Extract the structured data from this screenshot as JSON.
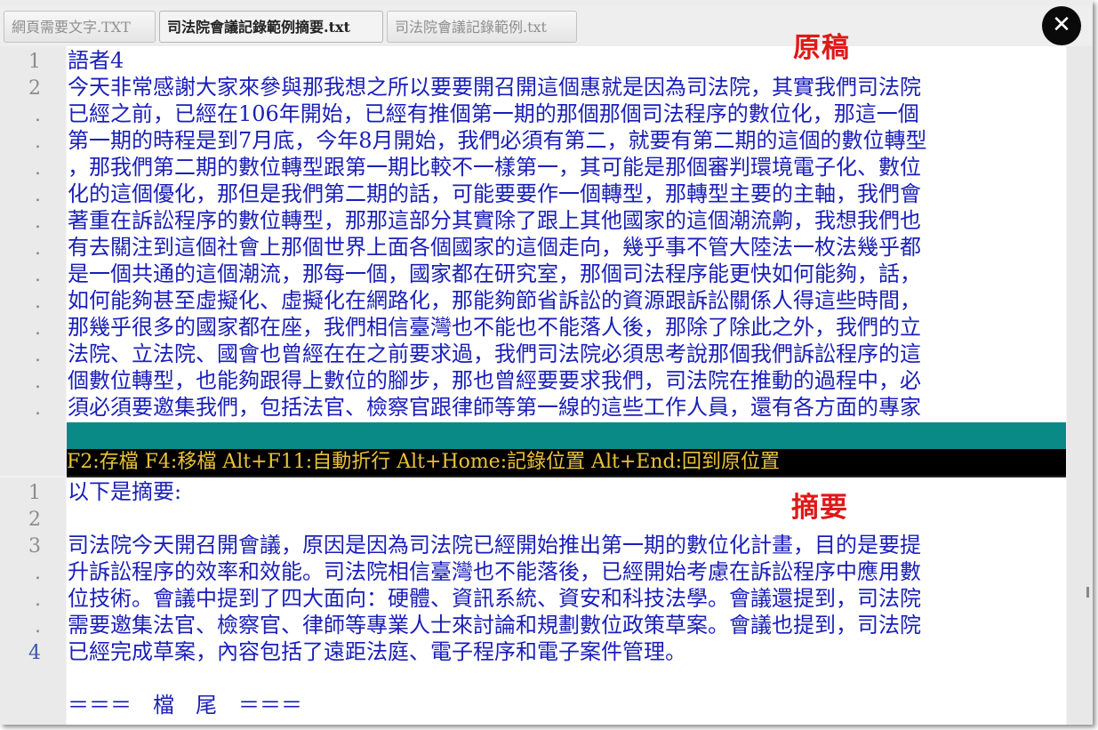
{
  "tabs": [
    {
      "label": "網頁需要文字.TXT",
      "active": false
    },
    {
      "label": "司法院會議記錄範例摘要.txt",
      "active": true
    },
    {
      "label": "司法院會議記錄範例.txt",
      "active": false
    }
  ],
  "close_icon": "close-icon",
  "original": {
    "heading": "原稿",
    "line_numbers": [
      "1",
      "2",
      ".",
      ".",
      ".",
      ".",
      ".",
      ".",
      ".",
      ".",
      ".",
      ".",
      ".",
      ".",
      "."
    ],
    "lines": [
      "語者4",
      "今天非常感謝大家來參與那我想之所以要要開召開這個惠就是因為司法院，其實我們司法院",
      "已經之前，已經在106年開始，已經有推個第一期的那個那個司法程序的數位化，那這一個",
      "第一期的時程是到7月底，今年8月開始，我們必須有第二，就要有第二期的這個的數位轉型",
      "，那我們第二期的數位轉型跟第一期比較不一樣第一，其可能是那個審判環境電子化、數位",
      "化的這個優化，那但是我們第二期的話，可能要要作一個轉型，那轉型主要的主軸，我們會",
      "著重在訴訟程序的數位轉型，那那這部分其實除了跟上其他國家的這個潮流齁，我想我們也",
      "有去關注到這個社會上那個世界上面各個國家的這個走向，幾乎事不管大陸法一枚法幾乎都",
      "是一個共通的這個潮流，那每一個，國家都在研究室，那個司法程序能更快如何能夠，話，",
      "如何能夠甚至虛擬化、虛擬化在網路化，那能夠節省訴訟的資源跟訴訟關係人得這些時間，",
      "那幾乎很多的國家都在座，我們相信臺灣也不能也不能落人後，那除了除此之外，我們的立",
      "法院、立法院、國會也曾經在在之前要求過，我們司法院必須思考說那個我們訴訟程序的這",
      "個數位轉型，也能夠跟得上數位的腳步，那也曾經要要求我們，司法院在推動的過程中，必",
      "須必須要邀集我們，包括法官、檢察官跟律師等第一線的這些工作人員，還有各方面的專家"
    ]
  },
  "status_bar": "F2:存檔 F4:移檔 Alt+F11:自動折行 Alt+Home:記錄位置 Alt+End:回到原位置",
  "summary": {
    "heading": "摘要",
    "line_numbers": [
      "1",
      "2",
      "3",
      ".",
      ".",
      ".",
      "4"
    ],
    "lines": [
      "以下是摘要:",
      "",
      "司法院今天開召開會議，原因是因為司法院已經開始推出第一期的數位化計畫，目的是要提",
      "升訴訟程序的效率和效能。司法院相信臺灣也不能落後，已經開始考慮在訴訟程序中應用數",
      "位技術。會議中提到了四大面向：硬體、資訊系統、資安和科技法學。會議還提到，司法院",
      "需要邀集法官、檢察官、律師等專業人士來討論和規劃數位政策草案。會議也提到，司法院",
      "已經完成草案，內容包括了遠距法庭、電子程序和電子案件管理。",
      "",
      "＝＝＝　檔　尾　＝＝＝"
    ]
  },
  "colors": {
    "text": "#1a1fb8",
    "heading": "#e01818",
    "status_bg": "#000000",
    "status_text": "#e8c23a",
    "teal_bar": "#0a8a87"
  }
}
